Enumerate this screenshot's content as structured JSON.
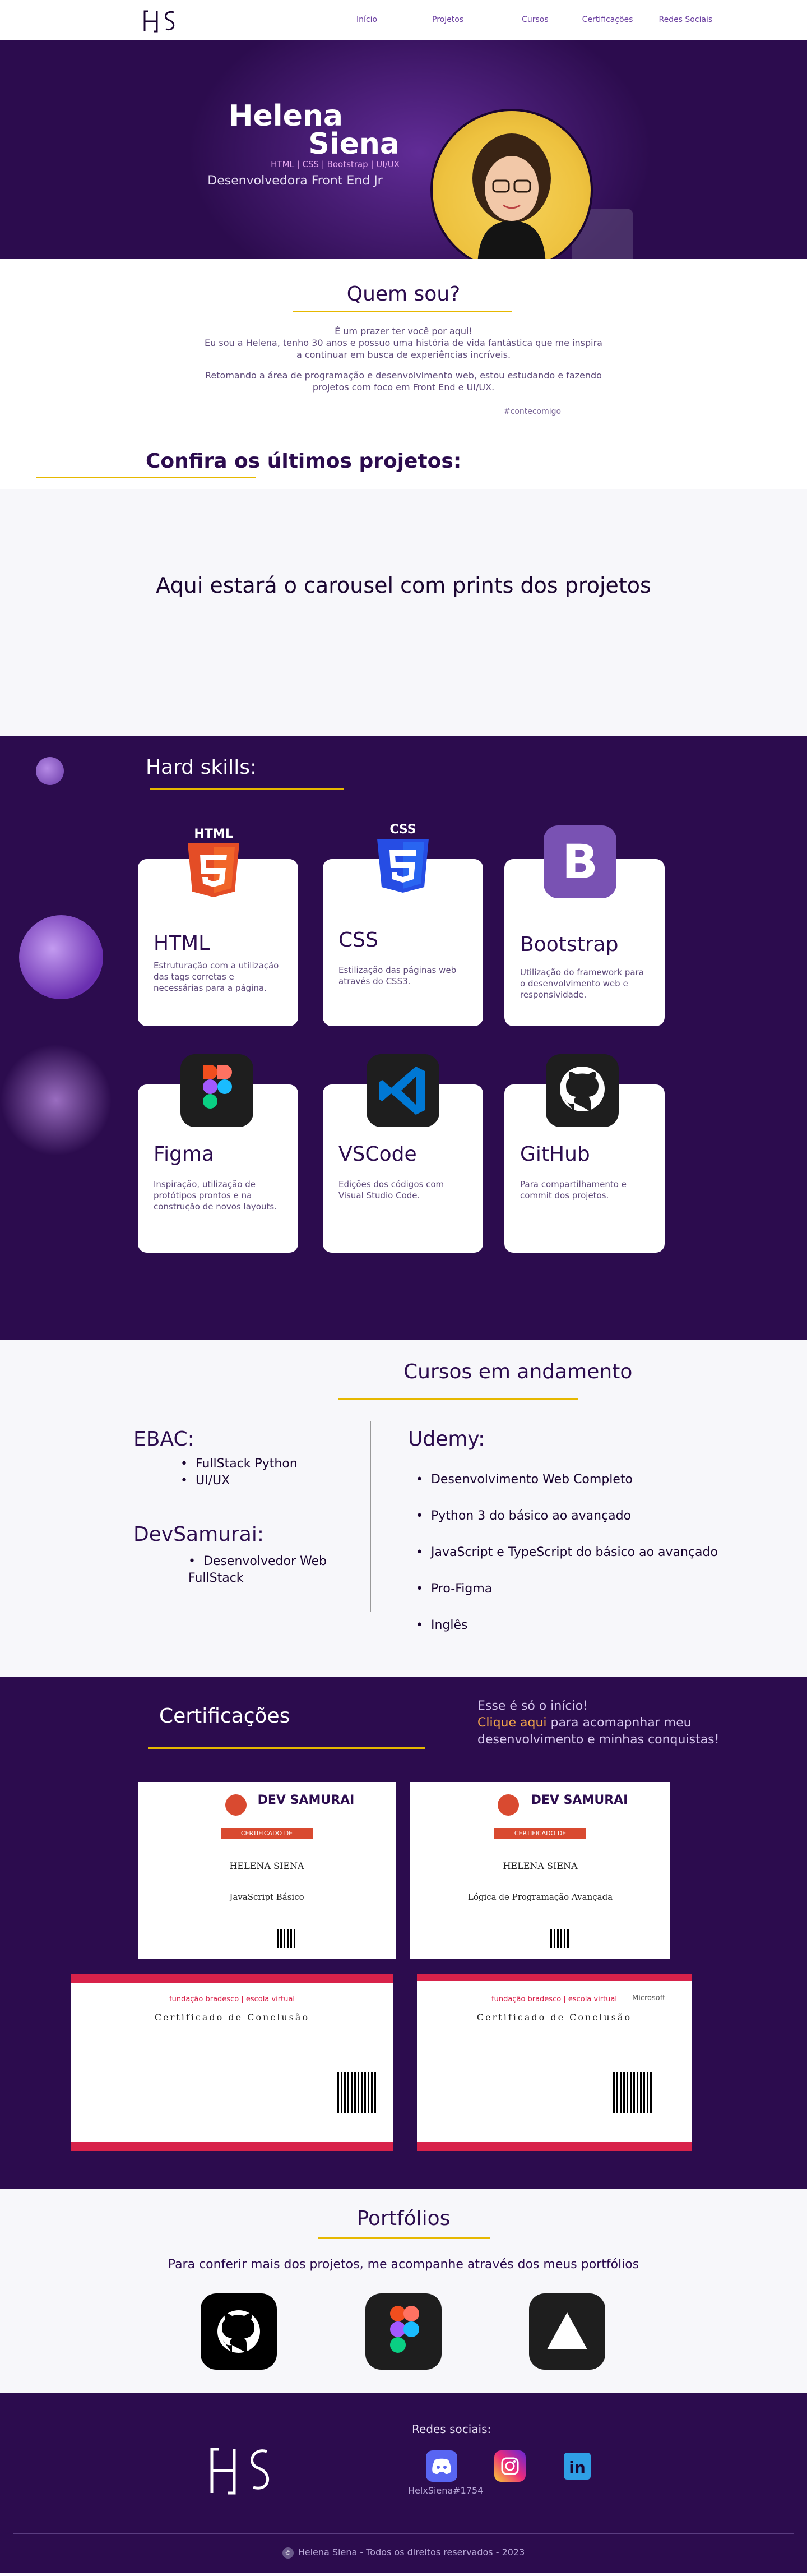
{
  "nav": {
    "logo_text": "HS",
    "items": [
      {
        "label": "Início"
      },
      {
        "label": "Projetos"
      },
      {
        "label": "Cursos"
      },
      {
        "label": "Certificações"
      },
      {
        "label": "Redes Sociais"
      }
    ]
  },
  "hero": {
    "first_name": "Helena",
    "last_name": "Siena",
    "stack": "HTML | CSS | Bootstrap | UI/UX",
    "role": "Desenvolvedora Front End Jr"
  },
  "about": {
    "title": "Quem sou?",
    "p1": "É um prazer ter você por aqui!",
    "p2": "Eu sou a Helena, tenho 30 anos e possuo uma história de vida fantástica que me inspira a continuar em busca de experiências incríveis.",
    "p3": "Retomando a área de programação e desenvolvimento web, estou estudando e fazendo projetos com foco em Front End e UI/UX.",
    "tag": "#contecomigo"
  },
  "projects": {
    "title": "Confira os últimos projetos:",
    "carousel_text": "Aqui estará o carousel com prints dos projetos"
  },
  "skills": {
    "title": "Hard skills:",
    "items": [
      {
        "name": "HTML",
        "desc": "Estruturação com a utilização das tags corretas e necessárias para a página.",
        "icon": "html5-icon"
      },
      {
        "name": "CSS",
        "desc": "Estilização das páginas web através do CSS3.",
        "icon": "css3-icon"
      },
      {
        "name": "Bootstrap",
        "desc": "Utilização do framework para o desenvolvimento web e responsividade.",
        "icon": "bootstrap-icon"
      },
      {
        "name": "Figma",
        "desc": "Inspiração, utilização de protótipos prontos e na construção de novos layouts.",
        "icon": "figma-icon"
      },
      {
        "name": "VSCode",
        "desc": "Edições dos códigos com Visual Studio Code.",
        "icon": "vscode-icon"
      },
      {
        "name": "GitHub",
        "desc": "Para compartilhamento e commit dos projetos.",
        "icon": "github-icon"
      }
    ]
  },
  "courses": {
    "title": "Cursos em andamento",
    "ebac": {
      "name": "EBAC:",
      "items": [
        "FullStack Python",
        "UI/UX"
      ]
    },
    "devsamurai": {
      "name": "DevSamurai:",
      "items": [
        "Desenvolvedor Web FullStack"
      ]
    },
    "udemy": {
      "name": "Udemy:",
      "items": [
        "Desenvolvimento Web Completo",
        "Python 3 do básico ao avançado",
        "JavaScript e TypeScript do básico ao avançado",
        "Pro-Figma",
        "Inglês"
      ]
    }
  },
  "certs": {
    "title": "Certificações",
    "note_1": "Esse é só o início!",
    "note_link": "Clique aqui",
    "note_2": " para acomapnhar meu desenvolvimento e minhas conquistas!",
    "ds_brand": "DEV SAMURAI",
    "ds_ribbon": "CERTIFICADO DE PARTICIPAÇÃO",
    "ds_name": "HELENA SIENA",
    "ds_course_1": "JavaScript Básico",
    "ds_course_2": "Lógica de Programação Avançada",
    "brad_brand": "fundação bradesco | escola virtual",
    "brad_title": "Certificado de Conclusão",
    "brad_partner": "Microsoft"
  },
  "portfolios": {
    "title": "Portfólios",
    "subtitle": "Para conferir mais dos projetos, me acompanhe através dos meus portfólios"
  },
  "footer": {
    "social_title": "Redes sociais:",
    "discord_user": "HelxSiena#1754",
    "copyright": "Helena Siena - Todos os direitos reservados - 2023"
  }
}
